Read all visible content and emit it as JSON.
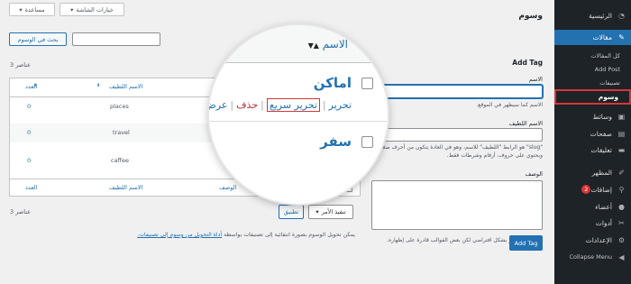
{
  "topbar": {
    "screen_options": "خيارات الشاشة",
    "help": "مساعدة"
  },
  "page_title": "وسوم",
  "sidebar": {
    "items": [
      {
        "label": "الرئيسية",
        "icon": "dashboard-icon"
      },
      {
        "label": "مقالات",
        "icon": "pin-icon"
      },
      {
        "label": "وسائط",
        "icon": "media-icon"
      },
      {
        "label": "صفحات",
        "icon": "page-icon"
      },
      {
        "label": "تعليقات",
        "icon": "comment-icon"
      },
      {
        "label": "المظهر",
        "icon": "brush-icon"
      },
      {
        "label": "إضافات",
        "icon": "plugin-icon",
        "badge": "2"
      },
      {
        "label": "أعضاء",
        "icon": "user-icon"
      },
      {
        "label": "أدوات",
        "icon": "wrench-icon"
      },
      {
        "label": "الإعدادات",
        "icon": "settings-icon"
      },
      {
        "label": "Collapse Menu",
        "icon": "collapse-icon"
      }
    ],
    "submenu": [
      "كل المقالات",
      "Add Post",
      "تصنيفات",
      "وسوم"
    ]
  },
  "search": {
    "button": "بحث في الوسوم"
  },
  "items_count": "3 عناصر",
  "table": {
    "headers": {
      "name": "الاسم",
      "slug": "الاسم اللطيف",
      "count": "العدد",
      "description": "الوصف"
    },
    "rows": [
      {
        "slug": "places",
        "count": "0"
      },
      {
        "slug": "travel",
        "count": "0"
      },
      {
        "slug": "caffee",
        "count": "0"
      }
    ]
  },
  "bulk": {
    "select": "تنفيذ الأمر",
    "apply": "تطبيق"
  },
  "note": {
    "text": "يمكن تحويل الوسوم بصورة انتقائية إلى تصنيفات بواسطة",
    "link": "أداة التحويل من وسوم إلى تصنيفات."
  },
  "form": {
    "heading": "Add Tag",
    "name_label": "الاسم",
    "name_help": "الاسم كما سيظهر في الموقع.",
    "slug_label": "الاسم اللطيف",
    "slug_help": "\"slug\" هو الرابط \"اللطيف\" للاسم، وهو في العادة يتكون من أحرف صغيرة ويحتوي على حروف، أرقام وشرطات فقط.",
    "desc_label": "الوصف",
    "desc_help": "الوصف لا يظهر بشكل افتراضي لكن بعض القوالب قادرة على إظهاره.",
    "submit": "Add Tag"
  },
  "magnifier": {
    "column_header": "الاسم",
    "row1_name": "اماكن",
    "actions": {
      "edit": "تحرير",
      "quick_edit": "تحرير سريع",
      "delete": "حذف",
      "view": "عرض"
    },
    "row2_name": "سفر"
  }
}
